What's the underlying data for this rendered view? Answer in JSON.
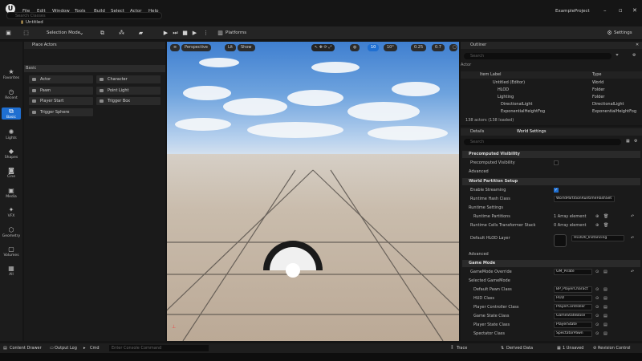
{
  "menu": [
    "File",
    "Edit",
    "Window",
    "Tools",
    "Build",
    "Select",
    "Actor",
    "Help"
  ],
  "project_tab": "Untitled",
  "project_name": "ExampleProject",
  "toolbar": {
    "selection_mode": "Selection Mode",
    "platforms": "Platforms",
    "settings": "Settings"
  },
  "rail": [
    {
      "label": "Favorites",
      "icon": "star-icon"
    },
    {
      "label": "Recent",
      "icon": "clock-icon"
    },
    {
      "label": "Basic",
      "icon": "cube-plus-icon"
    },
    {
      "label": "Lights",
      "icon": "bulb-icon"
    },
    {
      "label": "Shapes",
      "icon": "shapes-icon"
    },
    {
      "label": "Cine",
      "icon": "camera-icon"
    },
    {
      "label": "Media",
      "icon": "media-icon"
    },
    {
      "label": "VFX",
      "icon": "vfx-icon"
    },
    {
      "label": "Geometry",
      "icon": "geometry-icon"
    },
    {
      "label": "Volumes",
      "icon": "volume-icon"
    },
    {
      "label": "All",
      "icon": "all-icon"
    }
  ],
  "place_actors": {
    "title": "Place Actors",
    "search_placeholder": "Search Classes",
    "section": "Basic",
    "items": [
      "Actor",
      "Character",
      "Pawn",
      "Point Light",
      "Player Start",
      "Trigger Box",
      "Trigger Sphere"
    ]
  },
  "viewport": {
    "perspective": "Perspective",
    "lit": "Lit",
    "show": "Show",
    "grid": "10",
    "angle": "10°",
    "scale": "0.25",
    "camera_speed": "0.7"
  },
  "outliner": {
    "title": "Outliner",
    "search_placeholder": "Search",
    "actor_label": "Actor",
    "col_item": "Item Label",
    "col_type": "Type",
    "rows": [
      {
        "label": "Untitled (Editor)",
        "type": "World"
      },
      {
        "label": "HLOD",
        "type": "Folder"
      },
      {
        "label": "Lighting",
        "type": "Folder"
      },
      {
        "label": "DirectionalLight",
        "type": "DirectionalLight"
      },
      {
        "label": "ExponentialHeightFog",
        "type": "ExponentialHeightFog"
      }
    ],
    "count": "138 actors (138 loaded)"
  },
  "details": {
    "tab_details": "Details",
    "tab_world": "World Settings",
    "search_placeholder": "Search",
    "sections": {
      "precomputed": "Precomputed Visibility",
      "precomputed_vis": "Precomputed Visibility",
      "advanced1": "Advanced",
      "world_partition": "World Partition Setup",
      "enable_streaming": "Enable Streaming",
      "runtime_hash": "Runtime Hash Class",
      "runtime_hash_val": "WorldPartitionRuntimeHashSet",
      "runtime_settings": "Runtime Settings",
      "runtime_partitions": "Runtime Partitions",
      "runtime_partitions_val": "1 Array element",
      "runtime_cells": "Runtime Cells Transformer Stack",
      "runtime_cells_val": "0 Array element",
      "default_hlod": "Default HLOD Layer",
      "default_hlod_val": "HLOD0_Instancing",
      "advanced2": "Advanced",
      "game_mode": "Game Mode",
      "gamemode_override": "GameMode Override",
      "gamemode_override_val": "GM_Pirate",
      "selected_gamemode": "Selected GameMode",
      "default_pawn": "Default Pawn Class",
      "default_pawn_val": "BP_PlayerCharact",
      "hud": "HUD Class",
      "hud_val": "HUD",
      "player_controller": "Player Controller Class",
      "player_controller_val": "PlayerController",
      "game_state": "Game State Class",
      "game_state_val": "GameStateBase",
      "player_state": "Player State Class",
      "player_state_val": "PlayerState",
      "spectator": "Spectator Class",
      "spectator_val": "SpectatorPawn"
    }
  },
  "statusbar": {
    "content_drawer": "Content Drawer",
    "output_log": "Output Log",
    "cmd": "Cmd",
    "console_placeholder": "Enter Console Command",
    "trace": "Trace",
    "derived_data": "Derived Data",
    "unsaved": "1 Unsaved",
    "revision": "Revision Control"
  }
}
